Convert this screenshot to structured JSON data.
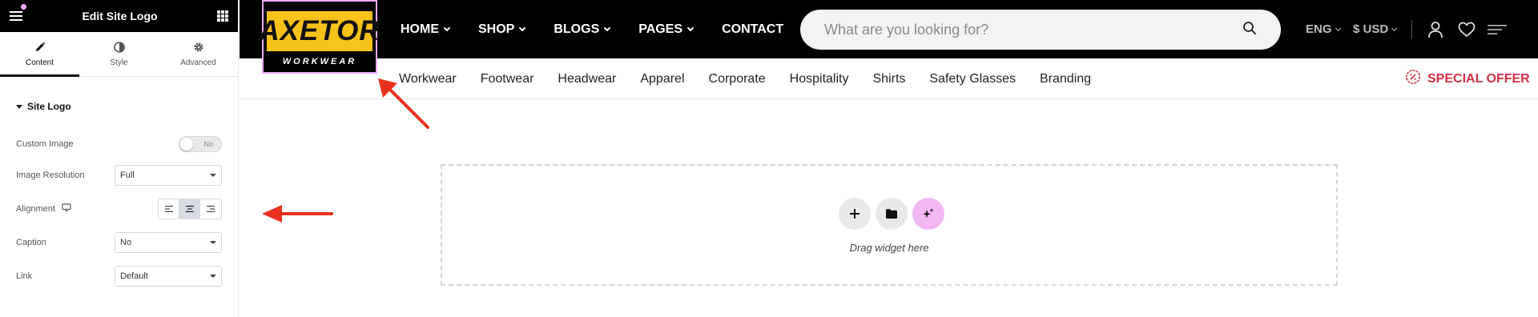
{
  "panel": {
    "title": "Edit Site Logo",
    "tabs": [
      {
        "label": "Content",
        "icon": "pencil-icon"
      },
      {
        "label": "Style",
        "icon": "half-circle-icon"
      },
      {
        "label": "Advanced",
        "icon": "gear-icon"
      }
    ],
    "section_title": "Site Logo",
    "controls": {
      "custom_image": {
        "label": "Custom Image",
        "toggle_text": "No",
        "value": false
      },
      "image_resolution": {
        "label": "Image Resolution",
        "value": "Full"
      },
      "alignment": {
        "label": "Alignment",
        "selected": "center",
        "options": [
          "left",
          "center",
          "right"
        ]
      },
      "caption": {
        "label": "Caption",
        "value": "No"
      },
      "link": {
        "label": "Link",
        "value": "Default"
      }
    }
  },
  "site": {
    "logo": {
      "main": "AXETOR",
      "sub": "WORKWEAR"
    },
    "main_nav": [
      {
        "label": "HOME",
        "has_dropdown": true
      },
      {
        "label": "SHOP",
        "has_dropdown": true
      },
      {
        "label": "BLOGS",
        "has_dropdown": true
      },
      {
        "label": "PAGES",
        "has_dropdown": true
      },
      {
        "label": "CONTACT",
        "has_dropdown": false
      }
    ],
    "search": {
      "placeholder": "What are you looking for?"
    },
    "language": "ENG",
    "currency": "$ USD",
    "categories": [
      "Workwear",
      "Footwear",
      "Headwear",
      "Apparel",
      "Corporate",
      "Hospitality",
      "Shirts",
      "Safety Glasses",
      "Branding"
    ],
    "special_offer": "SPECIAL OFFER",
    "dropzone_text": "Drag widget here"
  },
  "colors": {
    "logo_yellow": "#f9c21a",
    "selection_outline": "#f0abfc",
    "special_offer": "#d32f46",
    "annotation_arrow": "#e8321f",
    "ai_button": "#f2b8f2"
  }
}
